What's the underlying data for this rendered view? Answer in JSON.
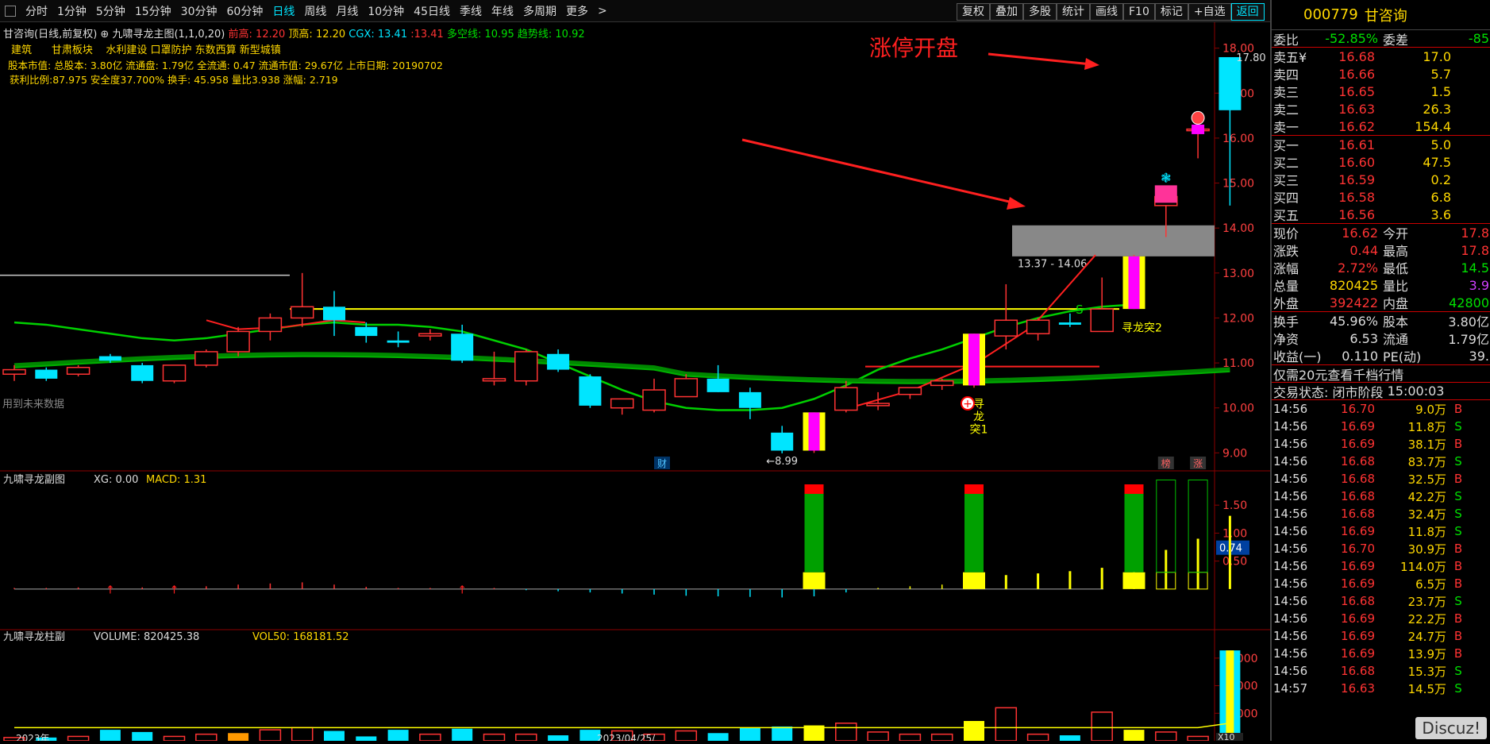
{
  "toolbar": {
    "tabs": [
      "分时",
      "1分钟",
      "5分钟",
      "15分钟",
      "30分钟",
      "60分钟",
      "日线",
      "周线",
      "月线",
      "10分钟",
      "45日线",
      "季线",
      "年线",
      "多周期",
      "更多"
    ],
    "active_tab": "日线",
    "more_chevron": ">",
    "right_buttons": [
      "复权",
      "叠加",
      "多股",
      "统计",
      "画线",
      "F10",
      "标记",
      "+自选",
      "返回"
    ]
  },
  "main_chart": {
    "title": "甘咨询(日线,前复权)",
    "indicator_name": "九啸寻龙主图(1,1,0,20)",
    "ind_qianhao_label": "前高:",
    "ind_qianhao_val": "12.20",
    "ind_dinggao_label": "顶高:",
    "ind_dinggao_val": "12.20",
    "ind_cgx_label": "CGX:",
    "ind_cgx_val": "13.41",
    "ind_extra_val": ":13.41",
    "ind_duokong_label": "多空线:",
    "ind_duokong_val": "10.95",
    "ind_qushi_label": "趋势线:",
    "ind_qushi_val": "10.92",
    "sectors": [
      "建筑",
      "甘肃板块",
      "水利建设 口罩防护 东数西算 新型城镇"
    ],
    "stock_info": "股本市值: 总股本: 3.80亿 流通盘: 1.79亿 全流通: 0.47 流通市值: 29.67亿 上市日期: 20190702",
    "ratios_line": "获利比例:87.975   安全度37.700%      换手: 45.958 量比3.938   涨幅: 2.719",
    "annotation_limit_open": "涨停开盘",
    "price_17_80": "17.80",
    "range_label": "13.37 - 14.06",
    "low_label": "←8.99",
    "future_data_note": "用到未来数据",
    "xunlong1_label": "寻\n龙\n突1",
    "xunlong2_label": "寻龙突2",
    "s_marker": "S",
    "bottom_badges": [
      "财",
      "榜",
      "涨"
    ],
    "y_axis": [
      "18.00",
      "17.00",
      "16.00",
      "15.00",
      "14.00",
      "13.00",
      "12.00",
      "11.00",
      "10.00",
      "9.00"
    ]
  },
  "sub_chart1": {
    "title": "九啸寻龙副图",
    "xg_label": "XG: 0.00",
    "macd_label": "MACD: 1.31",
    "y_axis": [
      "1.50",
      "1.00",
      "0.50"
    ],
    "current_value": "0.74"
  },
  "sub_chart2": {
    "title": "九啸寻龙柱副",
    "volume_label": "VOLUME: 820425.38",
    "vol50_label": "VOL50: 168181.52",
    "y_axis": [
      "75000",
      "50000",
      "25000"
    ],
    "unit": "X10",
    "date_label": "2023/04/25/",
    "left_date": "2023年"
  },
  "quote": {
    "code": "000779",
    "name": "甘咨询",
    "weibi_label": "委比",
    "weibi_val": "-52.85%",
    "weicha_label": "委差",
    "weicha_val": "-85",
    "asks": [
      {
        "label": "卖五",
        "price": "16.68",
        "vol": "17.0"
      },
      {
        "label": "卖四",
        "price": "16.66",
        "vol": "5.7"
      },
      {
        "label": "卖三",
        "price": "16.65",
        "vol": "1.5"
      },
      {
        "label": "卖二",
        "price": "16.63",
        "vol": "26.3"
      },
      {
        "label": "卖一",
        "price": "16.62",
        "vol": "154.4"
      }
    ],
    "ask_yen_marker": "¥",
    "bids": [
      {
        "label": "买一",
        "price": "16.61",
        "vol": "5.0"
      },
      {
        "label": "买二",
        "price": "16.60",
        "vol": "47.5"
      },
      {
        "label": "买三",
        "price": "16.59",
        "vol": "0.2"
      },
      {
        "label": "买四",
        "price": "16.58",
        "vol": "6.8"
      },
      {
        "label": "买五",
        "price": "16.56",
        "vol": "3.6"
      }
    ],
    "stats": [
      {
        "k1": "现价",
        "v1": "16.62",
        "c1": "red",
        "k2": "今开",
        "v2": "17.8",
        "c2": "red"
      },
      {
        "k1": "涨跌",
        "v1": "0.44",
        "c1": "red",
        "k2": "最高",
        "v2": "17.8",
        "c2": "red"
      },
      {
        "k1": "涨幅",
        "v1": "2.72%",
        "c1": "red",
        "k2": "最低",
        "v2": "14.5",
        "c2": "grn"
      },
      {
        "k1": "总量",
        "v1": "820425",
        "c1": "yel",
        "k2": "量比",
        "v2": "3.9",
        "c2": "mag"
      },
      {
        "k1": "外盘",
        "v1": "392422",
        "c1": "red",
        "k2": "内盘",
        "v2": "42800",
        "c2": "grn"
      }
    ],
    "stats2": [
      {
        "k1": "换手",
        "v1": "45.96%",
        "k2": "股本",
        "v2": "3.80亿"
      },
      {
        "k1": "净资",
        "v1": "6.53",
        "k2": "流通",
        "v2": "1.79亿"
      },
      {
        "k1": "收益(一)",
        "v1": "0.110",
        "k2": "PE(动)",
        "v2": "39."
      }
    ],
    "promo": "仅需20元查看千档行情",
    "status_label": "交易状态: 闭市阶段",
    "status_time": "15:00:03",
    "ticks": [
      {
        "t": "14:56",
        "p": "16.70",
        "v": "9.0万",
        "s": "B",
        "sc": "red",
        "vc": "yel"
      },
      {
        "t": "14:56",
        "p": "16.69",
        "v": "11.8万",
        "s": "S",
        "sc": "grn",
        "vc": "yel"
      },
      {
        "t": "14:56",
        "p": "16.69",
        "v": "38.1万",
        "s": "B",
        "sc": "red",
        "vc": "yel"
      },
      {
        "t": "14:56",
        "p": "16.68",
        "v": "83.7万",
        "s": "S",
        "sc": "grn",
        "vc": "mag"
      },
      {
        "t": "14:56",
        "p": "16.68",
        "v": "32.5万",
        "s": "B",
        "sc": "red",
        "vc": "yel"
      },
      {
        "t": "14:56",
        "p": "16.68",
        "v": "42.2万",
        "s": "S",
        "sc": "grn",
        "vc": "yel"
      },
      {
        "t": "14:56",
        "p": "16.68",
        "v": "32.4万",
        "s": "S",
        "sc": "grn",
        "vc": "yel"
      },
      {
        "t": "14:56",
        "p": "16.69",
        "v": "11.8万",
        "s": "S",
        "sc": "grn",
        "vc": "yel"
      },
      {
        "t": "14:56",
        "p": "16.70",
        "v": "30.9万",
        "s": "B",
        "sc": "red",
        "vc": "yel"
      },
      {
        "t": "14:56",
        "p": "16.69",
        "v": "114.0万",
        "s": "B",
        "sc": "red",
        "vc": "mag"
      },
      {
        "t": "14:56",
        "p": "16.69",
        "v": "6.5万",
        "s": "B",
        "sc": "red",
        "vc": "yel"
      },
      {
        "t": "14:56",
        "p": "16.68",
        "v": "23.7万",
        "s": "S",
        "sc": "grn",
        "vc": "yel"
      },
      {
        "t": "14:56",
        "p": "16.69",
        "v": "22.2万",
        "s": "B",
        "sc": "red",
        "vc": "yel"
      },
      {
        "t": "14:56",
        "p": "16.69",
        "v": "24.7万",
        "s": "B",
        "sc": "red",
        "vc": "yel"
      },
      {
        "t": "14:56",
        "p": "16.69",
        "v": "13.9万",
        "s": "B",
        "sc": "red",
        "vc": "yel"
      },
      {
        "t": "14:56",
        "p": "16.68",
        "v": "15.3万",
        "s": "S",
        "sc": "grn",
        "vc": "yel"
      },
      {
        "t": "14:57",
        "p": "16.63",
        "v": "14.5万",
        "s": "S",
        "sc": "grn",
        "vc": "yel"
      }
    ]
  },
  "watermark": "Discuz!",
  "colors": {
    "up": "#ff3333",
    "down": "#00e5ff",
    "bg": "#000000",
    "yellow": "#ffd800",
    "magenta": "#ff00ff",
    "green_ma": "#00c000",
    "red_ma": "#ff2020"
  },
  "candles": [
    {
      "o": 10.75,
      "h": 10.95,
      "l": 10.6,
      "c": 10.85
    },
    {
      "o": 10.85,
      "h": 10.9,
      "l": 10.6,
      "c": 10.65
    },
    {
      "o": 10.75,
      "h": 10.95,
      "l": 10.7,
      "c": 10.9
    },
    {
      "o": 11.15,
      "h": 11.2,
      "l": 11.0,
      "c": 11.05
    },
    {
      "o": 10.95,
      "h": 11.0,
      "l": 10.55,
      "c": 10.6
    },
    {
      "o": 10.6,
      "h": 10.95,
      "l": 10.55,
      "c": 10.95
    },
    {
      "o": 10.95,
      "h": 11.3,
      "l": 10.9,
      "c": 11.25
    },
    {
      "o": 11.25,
      "h": 11.8,
      "l": 11.15,
      "c": 11.7
    },
    {
      "o": 11.7,
      "h": 12.1,
      "l": 11.5,
      "c": 12.0
    },
    {
      "o": 12.0,
      "h": 13.0,
      "l": 11.8,
      "c": 12.25
    },
    {
      "o": 12.25,
      "h": 12.6,
      "l": 11.6,
      "c": 11.95
    },
    {
      "o": 11.8,
      "h": 11.9,
      "l": 11.45,
      "c": 11.6
    },
    {
      "o": 11.5,
      "h": 11.7,
      "l": 11.35,
      "c": 11.45
    },
    {
      "o": 11.6,
      "h": 11.75,
      "l": 11.5,
      "c": 11.65
    },
    {
      "o": 11.65,
      "h": 11.85,
      "l": 11.0,
      "c": 11.05
    },
    {
      "o": 10.6,
      "h": 11.25,
      "l": 10.5,
      "c": 10.65
    },
    {
      "o": 10.6,
      "h": 11.3,
      "l": 10.5,
      "c": 11.25
    },
    {
      "o": 11.2,
      "h": 11.3,
      "l": 10.8,
      "c": 10.85
    },
    {
      "o": 10.7,
      "h": 10.75,
      "l": 10.0,
      "c": 10.05
    },
    {
      "o": 10.0,
      "h": 10.2,
      "l": 9.85,
      "c": 10.2
    },
    {
      "o": 9.95,
      "h": 10.65,
      "l": 9.9,
      "c": 10.4
    },
    {
      "o": 10.25,
      "h": 10.75,
      "l": 10.25,
      "c": 10.65
    },
    {
      "o": 10.65,
      "h": 10.95,
      "l": 10.35,
      "c": 10.35
    },
    {
      "o": 10.35,
      "h": 10.45,
      "l": 9.75,
      "c": 10.0
    },
    {
      "o": 9.45,
      "h": 9.6,
      "l": 8.99,
      "c": 9.05
    },
    {
      "o": 9.05,
      "h": 9.9,
      "l": 9.0,
      "c": 9.9
    },
    {
      "o": 9.95,
      "h": 10.6,
      "l": 9.9,
      "c": 10.45
    },
    {
      "o": 10.05,
      "h": 10.35,
      "l": 9.95,
      "c": 10.1
    },
    {
      "o": 10.3,
      "h": 10.45,
      "l": 10.2,
      "c": 10.45
    },
    {
      "o": 10.5,
      "h": 10.65,
      "l": 10.4,
      "c": 10.6
    },
    {
      "o": 10.5,
      "h": 11.65,
      "l": 10.45,
      "c": 11.65
    },
    {
      "o": 11.6,
      "h": 12.75,
      "l": 11.3,
      "c": 11.95
    },
    {
      "o": 11.65,
      "h": 12.0,
      "l": 11.5,
      "c": 11.95
    },
    {
      "o": 11.9,
      "h": 12.1,
      "l": 11.8,
      "c": 11.85
    },
    {
      "o": 11.7,
      "h": 12.9,
      "l": 11.7,
      "c": 12.2
    },
    {
      "o": 12.2,
      "h": 13.4,
      "l": 12.2,
      "c": 13.37
    },
    {
      "o": 14.5,
      "h": 14.7,
      "l": 13.8,
      "c": 14.7
    },
    {
      "o": 16.2,
      "h": 16.45,
      "l": 15.55,
      "c": 16.2
    },
    {
      "o": 17.8,
      "h": 17.8,
      "l": 14.5,
      "c": 16.62
    }
  ],
  "volumes": [
    3,
    3,
    4,
    10,
    8,
    4,
    6,
    7,
    10,
    12,
    9,
    4,
    10,
    6,
    11,
    6,
    6,
    5,
    10,
    9,
    6,
    9,
    7,
    12,
    13,
    14,
    16,
    8,
    6,
    6,
    18,
    30,
    6,
    5,
    26,
    10,
    8,
    4,
    82
  ],
  "macd_bars": [
    0.02,
    0.02,
    0.03,
    0.03,
    0.03,
    0.04,
    0.05,
    0.08,
    0.1,
    0.12,
    0.08,
    0.04,
    0.02,
    0.02,
    0.02,
    0.02,
    -0.02,
    -0.04,
    -0.06,
    -0.08,
    -0.1,
    -0.12,
    -0.13,
    -0.14,
    -0.15,
    -0.13,
    -0.06,
    0.02,
    0.05,
    0.08,
    0.2,
    0.25,
    0.28,
    0.32,
    0.38,
    0.55,
    0.7,
    0.9,
    1.31
  ]
}
